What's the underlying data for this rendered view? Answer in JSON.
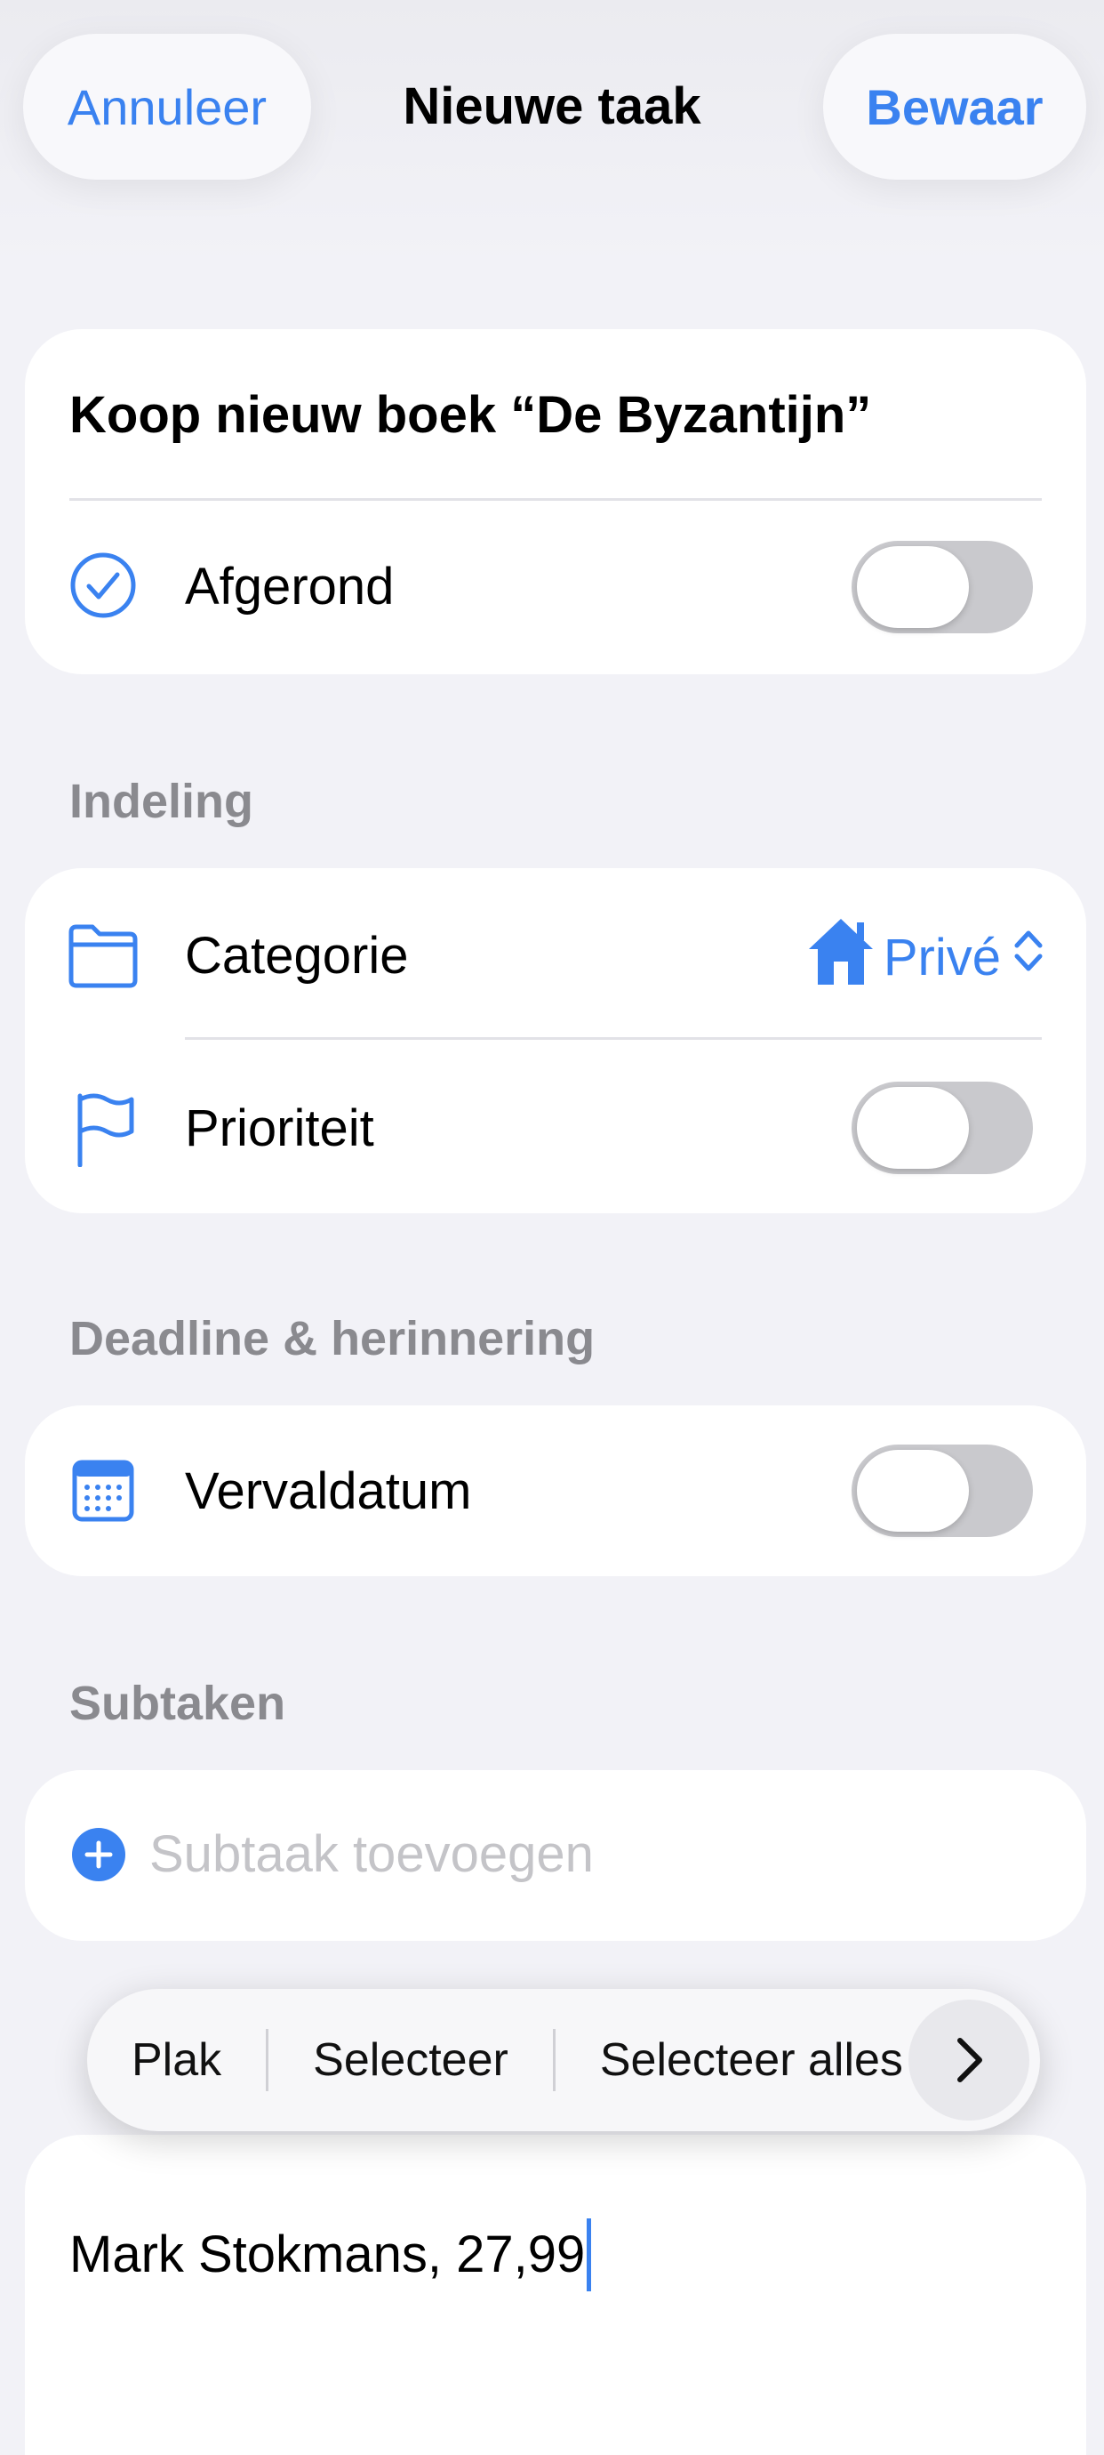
{
  "nav": {
    "cancel_label": "Annuleer",
    "title": "Nieuwe taak",
    "save_label": "Bewaar"
  },
  "task": {
    "title": "Koop nieuw boek “De Byzantijn”",
    "completed_label": "Afgerond",
    "completed": false
  },
  "layout_section": {
    "header": "Indeling",
    "category_label": "Categorie",
    "category_value": "Privé",
    "priority_label": "Prioriteit",
    "priority": false
  },
  "deadline_section": {
    "header": "Deadline & herinnering",
    "due_label": "Vervaldatum",
    "due_enabled": false
  },
  "subtasks_section": {
    "header": "Subtaken",
    "add_placeholder": "Subtaak toevoegen"
  },
  "edit_menu": {
    "paste": "Plak",
    "select": "Selecteer",
    "select_all": "Selecteer alles"
  },
  "notes": {
    "text": "Mark Stokmans, 27,99"
  },
  "colors": {
    "accent": "#3a82f0",
    "toggle_off": "#c9c9cd",
    "background": "#f2f2f7"
  }
}
